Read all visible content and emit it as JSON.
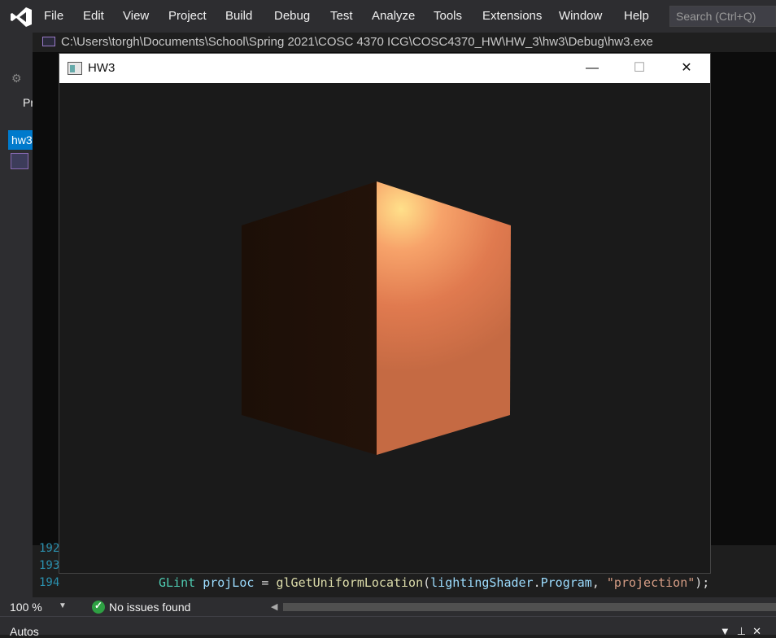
{
  "ide": {
    "menu": [
      "File",
      "Edit",
      "View",
      "Project",
      "Build",
      "Debug",
      "Test",
      "Analyze",
      "Tools",
      "Extensions",
      "Window",
      "Help"
    ],
    "search_placeholder": "Search (Ctrl+Q)",
    "left_partial_label": "Pr",
    "left_tab_label": "hw3"
  },
  "console": {
    "path": "C:\\Users\\torgh\\Documents\\School\\Spring 2021\\COSC 4370 ICG\\COSC4370_HW\\HW_3\\hw3\\Debug\\hw3.exe"
  },
  "app_window": {
    "title": "HW3",
    "minimize_glyph": "—",
    "maximize_glyph": "☐",
    "close_glyph": "✕"
  },
  "code": {
    "line_numbers": [
      "192",
      "193",
      "194"
    ],
    "line_194": {
      "type": "GLint",
      "var": "projLoc",
      "func": "glGetUniformLocation",
      "arg1": "lightingShader",
      "arg1_member": "Program",
      "arg2": "\"projection\""
    }
  },
  "status": {
    "zoom": "100 %",
    "issues": "No issues found"
  },
  "bottom_panel": {
    "title": "Autos"
  },
  "colors": {
    "cube_left": "#1c0f07",
    "cube_right": "#e07a4f",
    "highlight": "#ffe08a",
    "background": "#1a1a1a"
  }
}
